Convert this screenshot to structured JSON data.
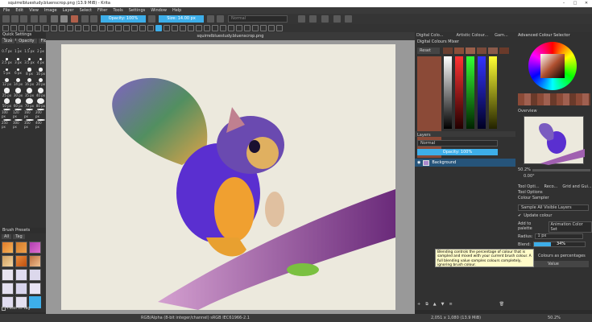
{
  "titlebar": {
    "title": "squirrelbluestudy.bluenscrop.png (13.9 MiB) - Krita"
  },
  "menu": [
    "File",
    "Edit",
    "View",
    "Image",
    "Layer",
    "Select",
    "Filter",
    "Tools",
    "Settings",
    "Window",
    "Help"
  ],
  "toolbar": {
    "opacity_label": "Opacity: 100%",
    "size_label": "Size: 14.00 px",
    "blend_mode": "Normal"
  },
  "document": {
    "tab_title": "squirrelbluestudy.bluenscrop.png"
  },
  "quick_settings": {
    "title": "Quick Settings Docker",
    "tabs": [
      "Size",
      "Opacity",
      "Flow"
    ],
    "sizes": [
      "0.7 px",
      "1 px",
      "1.5 px",
      "2 px",
      "2.5 px",
      "3 px",
      "3.5 px",
      "4 px",
      "5 px",
      "6 px",
      "8 px",
      "10 px",
      "12 px",
      "14 px",
      "16 px",
      "20 px",
      "25 px",
      "30 px",
      "35 px",
      "40 px",
      "50 px",
      "60 px",
      "70 px",
      "80 px",
      "100 px",
      "120 px",
      "160 px",
      "200 px",
      "250 px",
      "300 px",
      "350 px",
      "400 px"
    ]
  },
  "brush_presets": {
    "title": "Brush Presets",
    "filter_all": "All",
    "tag_label": "Tag",
    "filter_in_tag": "Filter in Tag"
  },
  "color_selector": {
    "tabs": [
      "Digital Colo...",
      "Artistic Colour...",
      "Gam..."
    ],
    "title": "Digital Colours Mixer",
    "reset": "Reset",
    "mixer_colors": [
      "#8b4a37",
      "#f2f2f2",
      "#d02020",
      "#20c020",
      "#2040d0",
      "#e0d020"
    ]
  },
  "advanced_color": {
    "title": "Advanced Colour Selector"
  },
  "layers": {
    "title": "Layers",
    "blend": "Normal",
    "opacity": "Opacity: 100%",
    "layer_name": "Background"
  },
  "overview": {
    "title": "Overview",
    "zoom": "50.2%",
    "rotation": "0.00°"
  },
  "tool_options": {
    "tabs": [
      "Tool Opti...",
      "Reco...",
      "Grid and Gui..."
    ],
    "title": "Tool Options",
    "section": "Colour Sampler",
    "sample_mode": "Sample All Visible Layers",
    "update_colour": "Update colour",
    "add_to_palette": "Add to palette",
    "palette": "Animation Color Set",
    "radius_label": "Radius:",
    "radius_value": "1 px",
    "blend_label": "Blend:",
    "blend_value": "34%",
    "blend_fraction": 0.34,
    "percentages_label": "Colours as percentages",
    "value_button": "Value"
  },
  "tooltip": {
    "text": "Blending controls the percentage of colour that is sampled and mixed with your current brush colour. A full blending value samples colours completely, ignoring brush colour."
  },
  "statusbar": {
    "color_info": "RGB/Alpha (8-bit integer/channel)  sRGB IEC61966-2.1",
    "dimensions": "2,051 x 1,080 (13.9 MiB)",
    "zoom": "50.2%"
  }
}
